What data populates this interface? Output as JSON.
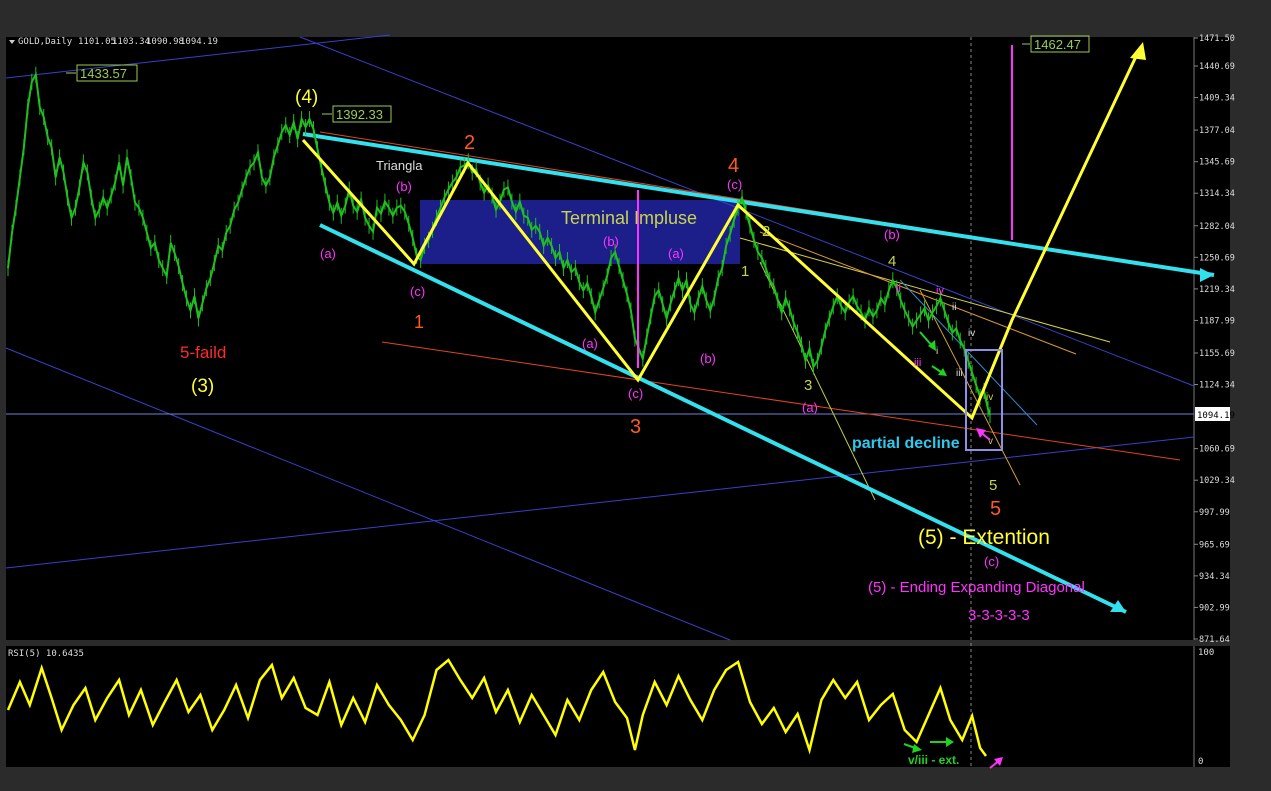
{
  "chart_data": {
    "type": "line",
    "title": "GOLD,Daily",
    "ohlc": {
      "open": 1101.05,
      "high": 1103.34,
      "low": 1090.98,
      "close": 1094.19
    },
    "price_axis": {
      "ticks": [
        1471.5,
        1440.69,
        1409.34,
        1377.04,
        1345.69,
        1314.34,
        1282.04,
        1250.69,
        1219.34,
        1187.99,
        1155.69,
        1124.34,
        1094.19,
        1060.69,
        1029.34,
        997.99,
        965.69,
        934.34,
        902.99,
        871.64
      ],
      "tick_labels": [
        "1471.50",
        "1440.69",
        "1409.34",
        "1377.04",
        "1345.69",
        "1314.34",
        "1282.04",
        "1250.69",
        "1219.34",
        "1187.99",
        "1155.69",
        "1124.34",
        "1094.19",
        "1060.69",
        "1029.34",
        "997.99",
        "965.69",
        "934.34",
        "902.99",
        "871.64"
      ],
      "current_price_label": "1094.19",
      "ylim": [
        871.64,
        1471.5
      ]
    },
    "rsi": {
      "label": "RSI(5) 10.6435",
      "ticks": [
        "100",
        "0"
      ],
      "ylim": [
        0,
        100
      ]
    },
    "price_tags": [
      {
        "text": "1433.57",
        "y": 1433.57
      },
      {
        "text": "1392.33",
        "y": 1392.33
      },
      {
        "text": "1462.47",
        "y": 1462.47
      }
    ],
    "annotations": {
      "terminal": "Terminal Impluse",
      "triangle": "Triangla",
      "failed": "5-faild",
      "wave3_main": "(3)",
      "wave4_main": "(4)",
      "partial": "partial decline",
      "extension": "(5) -  Extention",
      "diagonal": "(5) - Ending Expanding Diagonal",
      "structure": "3-3-3-3-3",
      "rsi_note": "v/iii - ext.",
      "w1": "1",
      "w2": "2",
      "w3": "3",
      "w4": "4",
      "w5": "5",
      "g1": "1",
      "g2": "2",
      "g3": "3",
      "g4": "4",
      "g5": "5",
      "a": "(a)",
      "b": "(b)",
      "c": "(c)",
      "r_i": "i",
      "r_ii": "ii",
      "r_iii": "iii",
      "r_iv": "iv",
      "r_v": "v"
    },
    "price_points": [
      [
        0,
        1240
      ],
      [
        4,
        1275
      ],
      [
        8,
        1300
      ],
      [
        12,
        1330
      ],
      [
        16,
        1360
      ],
      [
        20,
        1400
      ],
      [
        24,
        1425
      ],
      [
        28,
        1432
      ],
      [
        32,
        1400
      ],
      [
        36,
        1390
      ],
      [
        40,
        1370
      ],
      [
        44,
        1360
      ],
      [
        48,
        1330
      ],
      [
        52,
        1350
      ],
      [
        56,
        1335
      ],
      [
        60,
        1310
      ],
      [
        64,
        1290
      ],
      [
        68,
        1300
      ],
      [
        72,
        1320
      ],
      [
        76,
        1345
      ],
      [
        80,
        1335
      ],
      [
        84,
        1310
      ],
      [
        88,
        1290
      ],
      [
        92,
        1298
      ],
      [
        96,
        1310
      ],
      [
        100,
        1300
      ],
      [
        104,
        1312
      ],
      [
        108,
        1325
      ],
      [
        112,
        1345
      ],
      [
        116,
        1322
      ],
      [
        120,
        1350
      ],
      [
        124,
        1330
      ],
      [
        128,
        1305
      ],
      [
        132,
        1300
      ],
      [
        136,
        1290
      ],
      [
        140,
        1275
      ],
      [
        144,
        1260
      ],
      [
        148,
        1265
      ],
      [
        152,
        1248
      ],
      [
        156,
        1240
      ],
      [
        160,
        1232
      ],
      [
        164,
        1265
      ],
      [
        168,
        1255
      ],
      [
        172,
        1242
      ],
      [
        176,
        1225
      ],
      [
        180,
        1210
      ],
      [
        184,
        1198
      ],
      [
        188,
        1212
      ],
      [
        192,
        1190
      ],
      [
        196,
        1205
      ],
      [
        200,
        1220
      ],
      [
        204,
        1230
      ],
      [
        208,
        1245
      ],
      [
        212,
        1262
      ],
      [
        216,
        1258
      ],
      [
        220,
        1275
      ],
      [
        224,
        1282
      ],
      [
        228,
        1298
      ],
      [
        232,
        1305
      ],
      [
        236,
        1318
      ],
      [
        240,
        1330
      ],
      [
        244,
        1340
      ],
      [
        248,
        1345
      ],
      [
        252,
        1355
      ],
      [
        256,
        1330
      ],
      [
        260,
        1322
      ],
      [
        264,
        1330
      ],
      [
        268,
        1350
      ],
      [
        272,
        1362
      ],
      [
        276,
        1375
      ],
      [
        280,
        1382
      ],
      [
        284,
        1372
      ],
      [
        288,
        1385
      ],
      [
        292,
        1368
      ],
      [
        296,
        1388
      ],
      [
        300,
        1380
      ],
      [
        304,
        1388
      ],
      [
        308,
        1378
      ],
      [
        312,
        1358
      ],
      [
        316,
        1340
      ],
      [
        320,
        1322
      ],
      [
        324,
        1305
      ],
      [
        328,
        1295
      ],
      [
        332,
        1305
      ],
      [
        336,
        1292
      ],
      [
        340,
        1302
      ],
      [
        344,
        1318
      ],
      [
        348,
        1302
      ],
      [
        352,
        1296
      ],
      [
        356,
        1308
      ],
      [
        360,
        1290
      ],
      [
        364,
        1282
      ],
      [
        368,
        1276
      ],
      [
        372,
        1300
      ],
      [
        376,
        1294
      ],
      [
        380,
        1306
      ],
      [
        384,
        1300
      ],
      [
        388,
        1292
      ],
      [
        392,
        1300
      ],
      [
        396,
        1302
      ],
      [
        400,
        1296
      ],
      [
        404,
        1284
      ],
      [
        408,
        1270
      ],
      [
        412,
        1252
      ],
      [
        416,
        1248
      ],
      [
        420,
        1262
      ],
      [
        424,
        1268
      ],
      [
        428,
        1278
      ],
      [
        432,
        1290
      ],
      [
        436,
        1300
      ],
      [
        440,
        1310
      ],
      [
        444,
        1318
      ],
      [
        448,
        1325
      ],
      [
        452,
        1330
      ],
      [
        456,
        1340
      ],
      [
        460,
        1342
      ],
      [
        464,
        1346
      ],
      [
        468,
        1335
      ],
      [
        472,
        1338
      ],
      [
        476,
        1325
      ],
      [
        480,
        1315
      ],
      [
        484,
        1322
      ],
      [
        488,
        1312
      ],
      [
        492,
        1298
      ],
      [
        496,
        1306
      ],
      [
        500,
        1318
      ],
      [
        504,
        1320
      ],
      [
        508,
        1306
      ],
      [
        512,
        1296
      ],
      [
        516,
        1306
      ],
      [
        520,
        1292
      ],
      [
        524,
        1290
      ],
      [
        528,
        1278
      ],
      [
        532,
        1282
      ],
      [
        536,
        1276
      ],
      [
        540,
        1262
      ],
      [
        544,
        1270
      ],
      [
        548,
        1262
      ],
      [
        552,
        1250
      ],
      [
        556,
        1256
      ],
      [
        560,
        1240
      ],
      [
        564,
        1248
      ],
      [
        568,
        1236
      ],
      [
        572,
        1240
      ],
      [
        576,
        1226
      ],
      [
        580,
        1218
      ],
      [
        584,
        1225
      ],
      [
        588,
        1212
      ],
      [
        592,
        1196
      ],
      [
        596,
        1208
      ],
      [
        600,
        1220
      ],
      [
        604,
        1232
      ],
      [
        608,
        1250
      ],
      [
        612,
        1256
      ],
      [
        616,
        1242
      ],
      [
        620,
        1228
      ],
      [
        624,
        1214
      ],
      [
        628,
        1198
      ],
      [
        632,
        1170
      ],
      [
        636,
        1160
      ],
      [
        640,
        1150
      ],
      [
        644,
        1172
      ],
      [
        648,
        1192
      ],
      [
        652,
        1212
      ],
      [
        656,
        1218
      ],
      [
        660,
        1204
      ],
      [
        664,
        1190
      ],
      [
        668,
        1205
      ],
      [
        672,
        1218
      ],
      [
        676,
        1230
      ],
      [
        680,
        1218
      ],
      [
        684,
        1228
      ],
      [
        688,
        1204
      ],
      [
        692,
        1196
      ],
      [
        696,
        1210
      ],
      [
        700,
        1222
      ],
      [
        704,
        1208
      ],
      [
        708,
        1198
      ],
      [
        712,
        1210
      ],
      [
        716,
        1230
      ],
      [
        720,
        1240
      ],
      [
        724,
        1262
      ],
      [
        728,
        1274
      ],
      [
        732,
        1288
      ],
      [
        736,
        1300
      ],
      [
        740,
        1310
      ],
      [
        744,
        1296
      ],
      [
        748,
        1282
      ],
      [
        752,
        1268
      ],
      [
        756,
        1256
      ],
      [
        760,
        1250
      ],
      [
        764,
        1240
      ],
      [
        768,
        1228
      ],
      [
        772,
        1222
      ],
      [
        776,
        1208
      ],
      [
        780,
        1196
      ],
      [
        784,
        1210
      ],
      [
        788,
        1200
      ],
      [
        792,
        1186
      ],
      [
        796,
        1176
      ],
      [
        800,
        1164
      ],
      [
        804,
        1148
      ],
      [
        808,
        1160
      ],
      [
        812,
        1142
      ],
      [
        816,
        1148
      ],
      [
        820,
        1162
      ],
      [
        824,
        1178
      ],
      [
        828,
        1190
      ],
      [
        832,
        1202
      ],
      [
        836,
        1212
      ],
      [
        840,
        1202
      ],
      [
        844,
        1196
      ],
      [
        848,
        1206
      ],
      [
        852,
        1212
      ],
      [
        856,
        1202
      ],
      [
        860,
        1196
      ],
      [
        864,
        1188
      ],
      [
        868,
        1200
      ],
      [
        872,
        1192
      ],
      [
        876,
        1198
      ],
      [
        880,
        1210
      ],
      [
        884,
        1204
      ],
      [
        888,
        1218
      ],
      [
        892,
        1228
      ],
      [
        896,
        1220
      ],
      [
        900,
        1208
      ],
      [
        904,
        1198
      ],
      [
        908,
        1190
      ],
      [
        912,
        1182
      ],
      [
        916,
        1188
      ],
      [
        920,
        1194
      ],
      [
        924,
        1200
      ],
      [
        928,
        1188
      ],
      [
        932,
        1196
      ],
      [
        936,
        1202
      ],
      [
        940,
        1210
      ],
      [
        944,
        1198
      ],
      [
        948,
        1186
      ],
      [
        952,
        1176
      ],
      [
        956,
        1180
      ],
      [
        960,
        1168
      ],
      [
        964,
        1160
      ],
      [
        968,
        1148
      ],
      [
        972,
        1136
      ],
      [
        976,
        1124
      ],
      [
        980,
        1112
      ],
      [
        984,
        1118
      ],
      [
        988,
        1100
      ],
      [
        990,
        1094
      ]
    ],
    "rsi_points": [
      [
        0,
        50
      ],
      [
        12,
        78
      ],
      [
        22,
        55
      ],
      [
        34,
        92
      ],
      [
        44,
        62
      ],
      [
        54,
        30
      ],
      [
        66,
        55
      ],
      [
        78,
        72
      ],
      [
        88,
        40
      ],
      [
        100,
        62
      ],
      [
        112,
        80
      ],
      [
        122,
        45
      ],
      [
        134,
        70
      ],
      [
        146,
        35
      ],
      [
        158,
        58
      ],
      [
        170,
        80
      ],
      [
        182,
        48
      ],
      [
        194,
        65
      ],
      [
        206,
        30
      ],
      [
        218,
        50
      ],
      [
        230,
        75
      ],
      [
        242,
        42
      ],
      [
        254,
        80
      ],
      [
        266,
        95
      ],
      [
        276,
        62
      ],
      [
        288,
        82
      ],
      [
        300,
        52
      ],
      [
        312,
        45
      ],
      [
        324,
        78
      ],
      [
        336,
        35
      ],
      [
        348,
        62
      ],
      [
        360,
        38
      ],
      [
        372,
        75
      ],
      [
        384,
        55
      ],
      [
        396,
        40
      ],
      [
        408,
        20
      ],
      [
        420,
        45
      ],
      [
        432,
        90
      ],
      [
        444,
        100
      ],
      [
        456,
        80
      ],
      [
        468,
        62
      ],
      [
        480,
        82
      ],
      [
        492,
        48
      ],
      [
        504,
        70
      ],
      [
        516,
        38
      ],
      [
        528,
        65
      ],
      [
        540,
        45
      ],
      [
        552,
        25
      ],
      [
        564,
        60
      ],
      [
        576,
        40
      ],
      [
        588,
        70
      ],
      [
        600,
        88
      ],
      [
        612,
        58
      ],
      [
        624,
        42
      ],
      [
        632,
        10
      ],
      [
        640,
        45
      ],
      [
        652,
        78
      ],
      [
        664,
        55
      ],
      [
        676,
        84
      ],
      [
        688,
        60
      ],
      [
        700,
        40
      ],
      [
        712,
        70
      ],
      [
        724,
        90
      ],
      [
        736,
        98
      ],
      [
        748,
        58
      ],
      [
        760,
        36
      ],
      [
        772,
        52
      ],
      [
        784,
        28
      ],
      [
        796,
        46
      ],
      [
        808,
        10
      ],
      [
        820,
        60
      ],
      [
        832,
        80
      ],
      [
        844,
        62
      ],
      [
        856,
        78
      ],
      [
        868,
        40
      ],
      [
        880,
        55
      ],
      [
        892,
        66
      ],
      [
        904,
        30
      ],
      [
        916,
        18
      ],
      [
        928,
        45
      ],
      [
        940,
        72
      ],
      [
        950,
        40
      ],
      [
        962,
        20
      ],
      [
        972,
        44
      ],
      [
        980,
        12
      ],
      [
        986,
        4
      ]
    ]
  },
  "colors": {
    "price": "#1fbf1f",
    "rsi": "#ffff00",
    "channel": "#33e0ee",
    "arrows": "#ffff33",
    "blueband": "#1c1f8a",
    "wave_orange": "#ff5a1e",
    "wave_magenta": "#ff33ff",
    "wave_yellowgreen": "#c8d44a"
  }
}
